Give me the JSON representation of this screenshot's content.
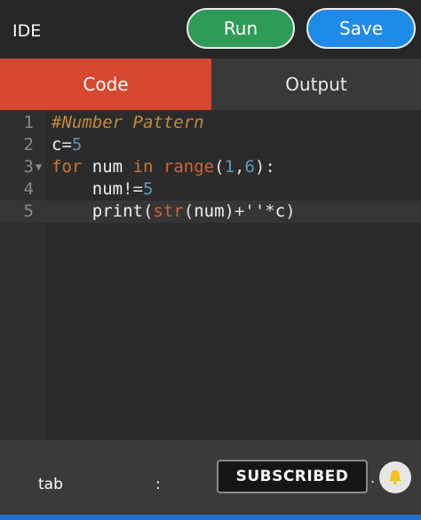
{
  "header": {
    "title": "IDE",
    "run_label": "Run",
    "save_label": "Save"
  },
  "tabs": [
    {
      "label": "Code",
      "active": true
    },
    {
      "label": "Output",
      "active": false
    }
  ],
  "editor": {
    "lines": [
      {
        "num": "1",
        "text": "#Number Pattern"
      },
      {
        "num": "2",
        "text": "c=5"
      },
      {
        "num": "3",
        "text": "for num in range(1,6):"
      },
      {
        "num": "4",
        "text": "    num!=5"
      },
      {
        "num": "5",
        "text": "    print(str(num)+''*c)"
      }
    ]
  },
  "footer": {
    "tab_label": "tab",
    "colon_label": ":",
    "subscribed_label": "SUBSCRIBED",
    "dot_label": "."
  },
  "colors": {
    "accent_tab": "#d8472f",
    "run_button": "#2e9b58",
    "save_button": "#1f8be8"
  },
  "icons": {
    "bell": "bell-icon",
    "fold": "fold-arrow-icon"
  }
}
